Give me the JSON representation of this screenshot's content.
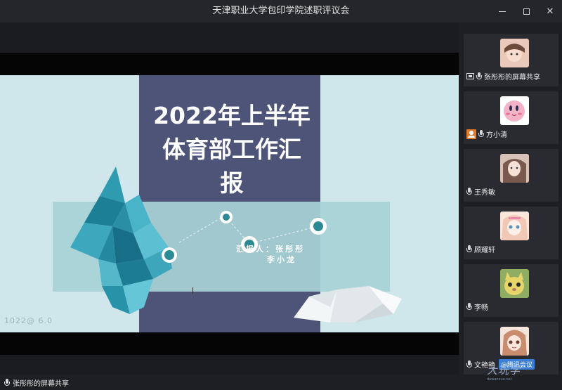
{
  "window": {
    "title": "天津职业大学包印学院述职评议会",
    "controls": {
      "minimize": "minimize-icon",
      "maximize": "maximize-icon",
      "close": "close-icon"
    }
  },
  "slide": {
    "title_line1": "2022年上半年",
    "title_line2": "体育部工作汇",
    "title_line3": "报",
    "reporter_line1": "汇报人：张彤彤",
    "reporter_line2": "李小龙",
    "watermark": "1022@ 6.0"
  },
  "participants": [
    {
      "name": "张彤彤的屏幕共享",
      "badge": "screen-share-icon",
      "avatar_color": "#e9c9b9"
    },
    {
      "name": "方小清",
      "badge": "host-icon",
      "avatar_color": "#f3b2c8"
    },
    {
      "name": "王秀敏",
      "badge": "",
      "avatar_color": "#d8c2b7"
    },
    {
      "name": "顾耀轩",
      "badge": "",
      "avatar_color": "#f1c7b5"
    },
    {
      "name": "李畅",
      "badge": "",
      "avatar_color": "#8fae63"
    },
    {
      "name": "文艳艳",
      "badge": "",
      "avatar_color": "#c98c6e",
      "brand_badge": "@腾讯会议"
    }
  ],
  "status": {
    "sharing_label": "张彤彤的屏幕共享"
  },
  "brand": {
    "mark": "大玩学",
    "mark_small": "dawanxue.net"
  },
  "colors": {
    "slide_background": "#cfe6ea",
    "slide_panel": "#4d5478",
    "accent_teal": "#2b8a94",
    "host_badge": "#e07b2e"
  }
}
